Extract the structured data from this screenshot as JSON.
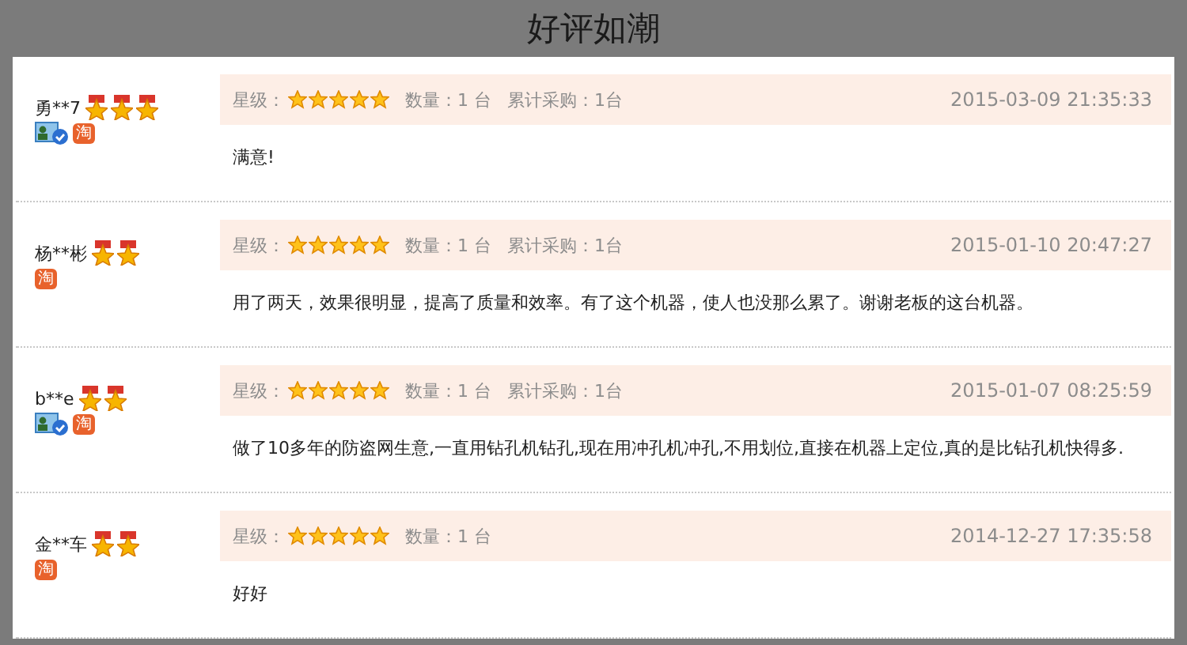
{
  "title": "好评如潮",
  "reviews": [
    {
      "user": {
        "name": "勇**7",
        "medals": [
          {
            "kind": "medal"
          },
          {
            "kind": "medal"
          },
          {
            "kind": "medal"
          }
        ]
      },
      "verified": true,
      "badge": "淘",
      "rating_label": "星级：",
      "stars": 5,
      "meta": [
        "数量：1 台",
        "累计采购：1台"
      ],
      "date": "2015-03-09 21:35:33",
      "text": "满意!"
    },
    {
      "user": {
        "name": "杨**彬",
        "medals": [
          {
            "kind": "medal"
          },
          {
            "kind": "medal"
          }
        ]
      },
      "verified": false,
      "badge": "淘",
      "rating_label": "星级：",
      "stars": 5,
      "meta": [
        "数量：1 台",
        "累计采购：1台"
      ],
      "date": "2015-01-10 20:47:27",
      "text": "用了两天，效果很明显，提高了质量和效率。有了这个机器，使人也没那么累了。谢谢老板的这台机器。"
    },
    {
      "user": {
        "name": "b**e",
        "medals": [
          {
            "kind": "medal"
          },
          {
            "kind": "medal"
          }
        ]
      },
      "verified": true,
      "badge": "淘",
      "rating_label": "星级：",
      "stars": 5,
      "meta": [
        "数量：1 台",
        "累计采购：1台"
      ],
      "date": "2015-01-07 08:25:59",
      "text": "做了10多年的防盗网生意,一直用钻孔机钻孔,现在用冲孔机冲孔,不用划位,直接在机器上定位,真的是比钻孔机快得多."
    },
    {
      "user": {
        "name": "金**车",
        "medals": [
          {
            "kind": "medal"
          },
          {
            "kind": "medal"
          }
        ]
      },
      "verified": false,
      "badge": "淘",
      "rating_label": "星级：",
      "stars": 5,
      "meta": [
        "数量：1 台"
      ],
      "date": "2014-12-27 17:35:58",
      "text": "好好"
    }
  ]
}
